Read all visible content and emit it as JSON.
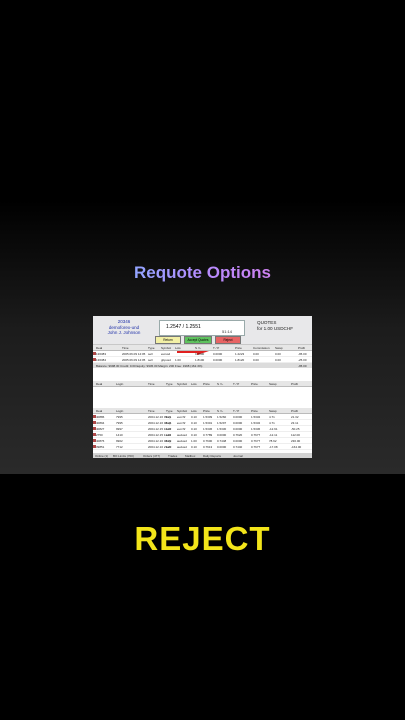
{
  "headline": "Requote Options",
  "account": {
    "number": "20346",
    "server": "demoforex-und",
    "name": "John J. Johnson"
  },
  "price_display": "1.2547 / 1.2551",
  "timer": "51:14",
  "quotes_title": [
    "QUOTES",
    "for 1.00 USDCHF"
  ],
  "buttons": {
    "return": "Return",
    "accept": "Accept Quotes",
    "reject": "Reject"
  },
  "open_trades": {
    "headers": [
      "Deal",
      "Time",
      "Type",
      "Symbol",
      "Lots",
      "S / L",
      "T / P",
      "Price",
      "Commission",
      "Swap",
      "Profit"
    ],
    "rows": [
      [
        "136383",
        "2005.06.09 14:05",
        "sell",
        "eurusd",
        "",
        "0.0000",
        "0.0000",
        "1.2223",
        "0.00",
        "0.00",
        "-95.00"
      ],
      [
        "136384",
        "2005.06.09 14:05",
        "sell",
        "gbpusd",
        "1.00",
        "1.8100",
        "0.0000",
        "1.8120",
        "0.00",
        "0.00",
        "-25.00"
      ]
    ],
    "balance": "Balance: 9998.30   Credit: 0.00   Equity: 9945.30   Margin: 200   Free: 1998   (162.4%)",
    "balance_total": "-95.00"
  },
  "pending": {
    "headers": [
      "Deal",
      "Login",
      "Time",
      "Type",
      "Symbol",
      "Lots",
      "Price",
      "S / L",
      "T / P",
      "Price",
      "Swap",
      "Profit"
    ]
  },
  "history": {
    "headers": [
      "Deal",
      "Login",
      "Time",
      "Type",
      "Symbol",
      "Lots",
      "Price",
      "S / L",
      "T / P",
      "Price",
      "Swap",
      "Profit"
    ],
    "rows": [
      [
        "40886",
        "7995",
        "2004.12.16 09:21",
        "buy",
        "eurchf",
        "0.10",
        "1.5309",
        "1.5260",
        "0.0000",
        "1.5332",
        "4.71",
        "21.32"
      ],
      [
        "40894",
        "7995",
        "2004.12.16 08:46",
        "buy",
        "eurchf",
        "0.10",
        "1.5301",
        "1.5297",
        "0.0000",
        "1.5332",
        "4.71",
        "23.11"
      ],
      [
        "40827",
        "9997",
        "2004.12.15 16:32",
        "sell",
        "eurchf",
        "0.10",
        "1.5336",
        "1.5330",
        "0.0000",
        "1.5336",
        "-12.91",
        "-50.25"
      ],
      [
        "2750",
        "1410",
        "2004.12.15 11:46",
        "sell",
        "audusd",
        "0.10",
        "0.7789",
        "0.0000",
        "0.7620",
        "0.7677",
        "-12.11",
        "112.00"
      ],
      [
        "40876",
        "9902",
        "2004.12.16 08:09",
        "buy",
        "audusd",
        "1.00",
        "0.7600",
        "0.7448",
        "0.0000",
        "0.7677",
        "78.92",
        "230.00"
      ],
      [
        "39851",
        "7712",
        "2004.12.10 23:20",
        "sell",
        "audusd",
        "0.10",
        "0.7613",
        "0.0000",
        "0.7440",
        "0.7677",
        "-17.08",
        "-164.00"
      ]
    ]
  },
  "tabs": [
    "Online (1)",
    "BO Limits (700)",
    "Orders (477)",
    "Trades",
    "Mailbox",
    "Daily Reports",
    "Journal"
  ],
  "bottom_word": "REJECT",
  "colors": {
    "headline_gradient": [
      "#4fd6ff",
      "#b58cff",
      "#ff6ad0"
    ],
    "bottom_word": "#f3e51a",
    "accept": "#5ec25e",
    "reject": "#e86464",
    "arrow": "#e02020"
  }
}
